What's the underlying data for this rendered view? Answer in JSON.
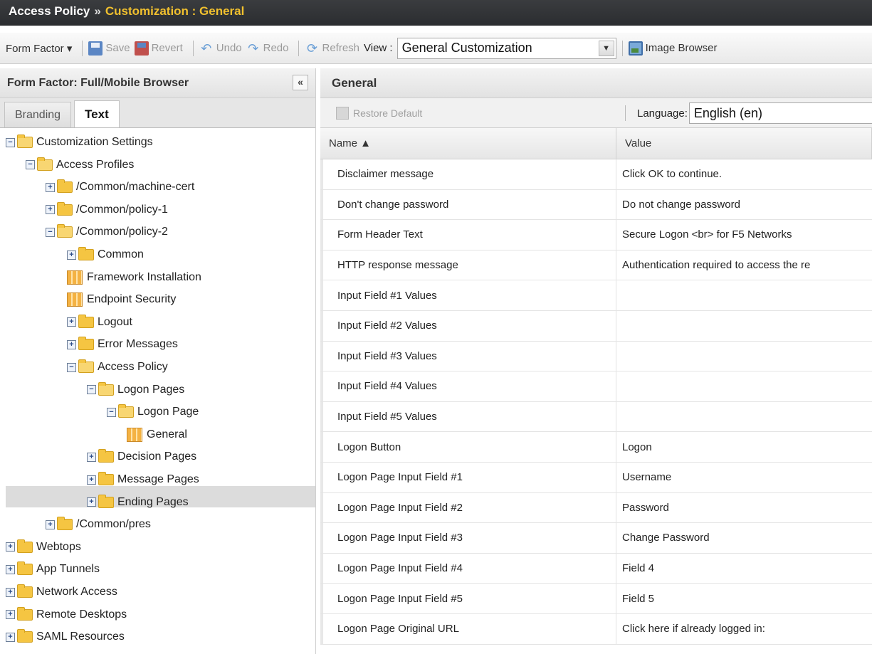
{
  "header": {
    "title": "Access Policy",
    "separator": "»",
    "subtitle": "Customization : General"
  },
  "toolbar": {
    "form_factor": "Form Factor ▾",
    "save": "Save",
    "revert": "Revert",
    "undo": "Undo",
    "redo": "Redo",
    "refresh": "Refresh",
    "view_label": "View :",
    "view_value": "General Customization",
    "image_browser": "Image Browser"
  },
  "left_panel": {
    "title": "Form Factor: Full/Mobile Browser",
    "collapse": "«",
    "tabs": [
      "Branding",
      "Text"
    ],
    "tree": [
      {
        "label": "Customization Settings",
        "exp": "⊟",
        "icon": "folder-open"
      },
      {
        "label": "Access Profiles",
        "exp": "⊟",
        "icon": "folder-open"
      },
      {
        "label": "/Common/machine-cert",
        "exp": "⊞",
        "icon": "folder"
      },
      {
        "label": "/Common/policy-1",
        "exp": "⊞",
        "icon": "folder"
      },
      {
        "label": "/Common/policy-2",
        "exp": "⊟",
        "icon": "folder-open"
      },
      {
        "label": "Common",
        "exp": "⊞",
        "icon": "folder"
      },
      {
        "label": "Framework Installation",
        "exp": "",
        "icon": "grid"
      },
      {
        "label": "Endpoint Security",
        "exp": "",
        "icon": "grid"
      },
      {
        "label": "Logout",
        "exp": "⊞",
        "icon": "folder"
      },
      {
        "label": "Error Messages",
        "exp": "⊞",
        "icon": "folder"
      },
      {
        "label": "Access Policy",
        "exp": "⊟",
        "icon": "folder-open"
      },
      {
        "label": "Logon Pages",
        "exp": "⊟",
        "icon": "folder-open"
      },
      {
        "label": "Logon Page",
        "exp": "⊟",
        "icon": "folder-open"
      },
      {
        "label": "General",
        "exp": "",
        "icon": "grid"
      },
      {
        "label": "Decision Pages",
        "exp": "⊞",
        "icon": "folder"
      },
      {
        "label": "Message Pages",
        "exp": "⊞",
        "icon": "folder"
      },
      {
        "label": "Ending Pages",
        "exp": "⊞",
        "icon": "folder"
      },
      {
        "label": "/Common/pres",
        "exp": "⊞",
        "icon": "folder"
      },
      {
        "label": "Webtops",
        "exp": "⊞",
        "icon": "folder"
      },
      {
        "label": "App Tunnels",
        "exp": "⊞",
        "icon": "folder"
      },
      {
        "label": "Network Access",
        "exp": "⊞",
        "icon": "folder"
      },
      {
        "label": "Remote Desktops",
        "exp": "⊞",
        "icon": "folder"
      },
      {
        "label": "SAML Resources",
        "exp": "⊞",
        "icon": "folder"
      }
    ]
  },
  "right_panel": {
    "title": "General",
    "restore_default": "Restore Default",
    "language_label": "Language:",
    "language_value": "English (en)",
    "columns": [
      "Name ▲",
      "Value"
    ],
    "rows": [
      {
        "name": "Disclaimer message",
        "value": "Click OK to continue."
      },
      {
        "name": "Don't change password",
        "value": "Do not change password"
      },
      {
        "name": "Form Header Text",
        "value": "Secure Logon <br> for F5 Networks"
      },
      {
        "name": "HTTP response message",
        "value": "Authentication required to access the re"
      },
      {
        "name": "Input Field #1 Values",
        "value": ""
      },
      {
        "name": "Input Field #2 Values",
        "value": ""
      },
      {
        "name": "Input Field #3 Values",
        "value": ""
      },
      {
        "name": "Input Field #4 Values",
        "value": ""
      },
      {
        "name": "Input Field #5 Values",
        "value": ""
      },
      {
        "name": "Logon Button",
        "value": "Logon"
      },
      {
        "name": "Logon Page Input Field #1",
        "value": "Username"
      },
      {
        "name": "Logon Page Input Field #2",
        "value": "Password"
      },
      {
        "name": "Logon Page Input Field #3",
        "value": "Change Password"
      },
      {
        "name": "Logon Page Input Field #4",
        "value": "Field 4"
      },
      {
        "name": "Logon Page Input Field #5",
        "value": "Field 5"
      },
      {
        "name": "Logon Page Original URL",
        "value": "Click here if already logged in:"
      }
    ]
  }
}
